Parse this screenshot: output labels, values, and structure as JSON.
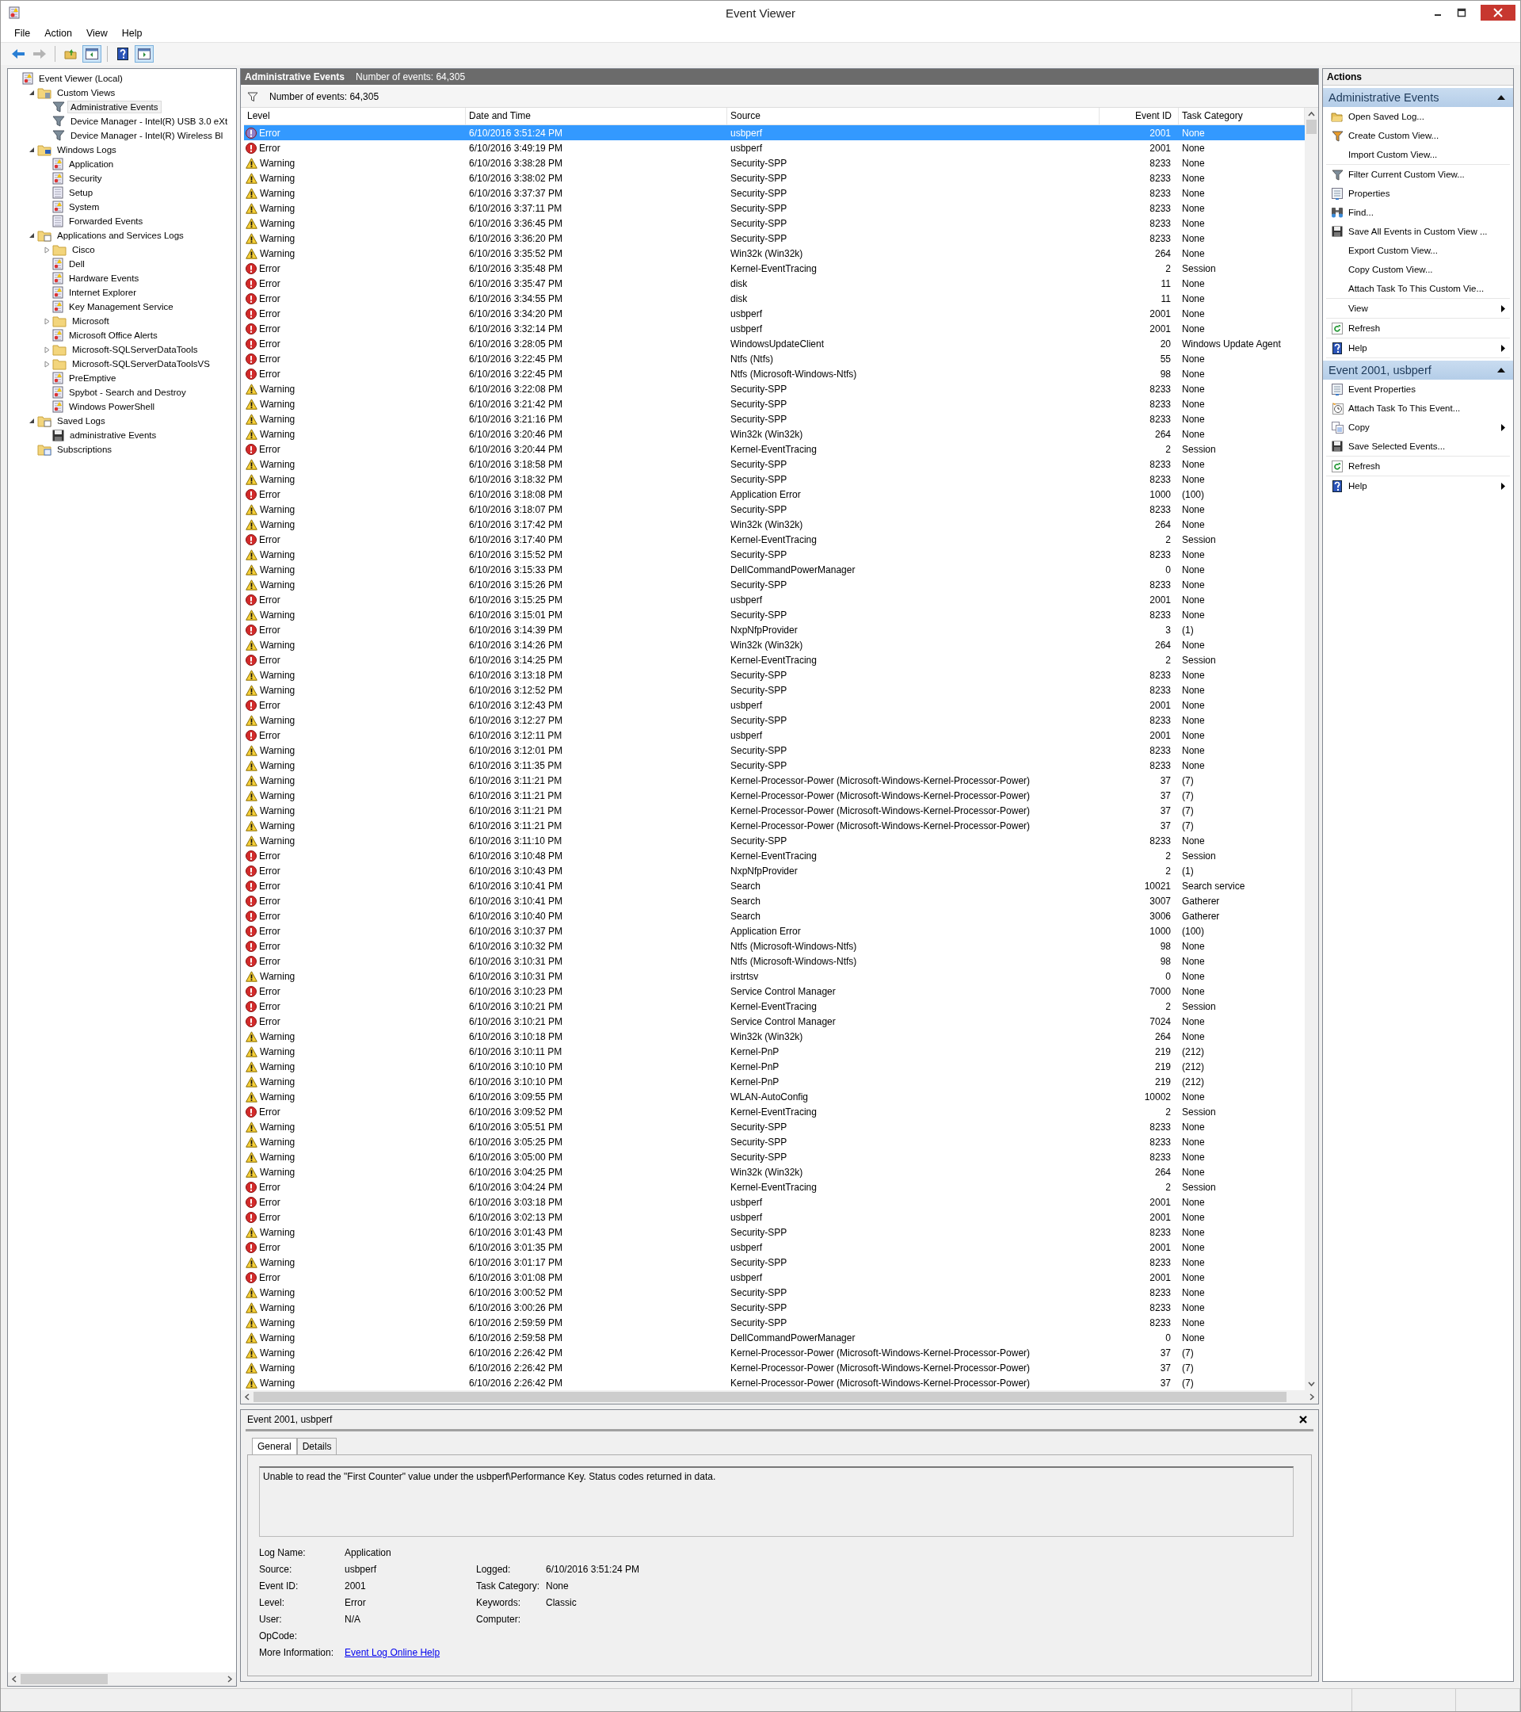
{
  "window": {
    "title": "Event Viewer"
  },
  "menu": [
    "File",
    "Action",
    "View",
    "Help"
  ],
  "toolbar": {
    "groups": [
      [
        {
          "kind": "back",
          "pressed": false,
          "disabled": false
        },
        {
          "kind": "forward",
          "pressed": false,
          "disabled": true
        }
      ],
      [
        {
          "kind": "up-folder",
          "pressed": false,
          "disabled": false
        },
        {
          "kind": "console-tree",
          "pressed": true,
          "disabled": false
        }
      ],
      [
        {
          "kind": "help",
          "pressed": false,
          "disabled": false
        },
        {
          "kind": "action-pane",
          "pressed": true,
          "disabled": false
        }
      ]
    ]
  },
  "tree": [
    {
      "label": "Event Viewer (Local)",
      "kind": "root",
      "selected": false,
      "children": [
        {
          "label": "Custom Views",
          "kind": "folder-filter",
          "expanded": true,
          "selected": false,
          "children": [
            {
              "label": "Administrative Events",
              "kind": "filter",
              "selected": true
            },
            {
              "label": "Device Manager - Intel(R) USB 3.0 eXt",
              "kind": "filter",
              "selected": false
            },
            {
              "label": "Device Manager - Intel(R) Wireless Bl",
              "kind": "filter",
              "selected": false
            }
          ]
        },
        {
          "label": "Windows Logs",
          "kind": "folder-computer",
          "expanded": true,
          "selected": false,
          "children": [
            {
              "label": "Application",
              "kind": "log",
              "selected": false
            },
            {
              "label": "Security",
              "kind": "log",
              "selected": false
            },
            {
              "label": "Setup",
              "kind": "plain-log",
              "selected": false
            },
            {
              "label": "System",
              "kind": "log",
              "selected": false
            },
            {
              "label": "Forwarded Events",
              "kind": "plain-log",
              "selected": false
            }
          ]
        },
        {
          "label": "Applications and Services Logs",
          "kind": "folder-window",
          "expanded": true,
          "selected": false,
          "children": [
            {
              "label": "Cisco",
              "kind": "folder",
              "expanded": false,
              "selected": false
            },
            {
              "label": "Dell",
              "kind": "log",
              "selected": false
            },
            {
              "label": "Hardware Events",
              "kind": "log",
              "selected": false
            },
            {
              "label": "Internet Explorer",
              "kind": "log",
              "selected": false
            },
            {
              "label": "Key Management Service",
              "kind": "log",
              "selected": false
            },
            {
              "label": "Microsoft",
              "kind": "folder",
              "expanded": false,
              "selected": false
            },
            {
              "label": "Microsoft Office Alerts",
              "kind": "log",
              "selected": false
            },
            {
              "label": "Microsoft-SQLServerDataTools",
              "kind": "folder",
              "expanded": false,
              "selected": false
            },
            {
              "label": "Microsoft-SQLServerDataToolsVS",
              "kind": "folder",
              "expanded": false,
              "selected": false
            },
            {
              "label": "PreEmptive",
              "kind": "log",
              "selected": false
            },
            {
              "label": "Spybot - Search and Destroy",
              "kind": "log",
              "selected": false
            },
            {
              "label": "Windows PowerShell",
              "kind": "log",
              "selected": false
            }
          ]
        },
        {
          "label": "Saved Logs",
          "kind": "folder-log",
          "expanded": true,
          "selected": false,
          "children": [
            {
              "label": "administrative Events",
              "kind": "saved",
              "selected": false
            }
          ]
        },
        {
          "label": "Subscriptions",
          "kind": "subscriptions",
          "selected": false
        }
      ]
    }
  ],
  "events": {
    "title": "Administrative Events",
    "count": "Number of events: 64,305",
    "filter_count": "Number of events: 64,305",
    "columns": [
      "Level",
      "Date and Time",
      "Source",
      "Event ID",
      "Task Category"
    ],
    "rows": [
      {
        "kind": "error",
        "severity": "Error",
        "date_time": "6/10/2016 3:51:24 PM",
        "source": "usbperf",
        "event_id": "2001",
        "task_category": "None",
        "selected": true
      },
      {
        "kind": "error",
        "severity": "Error",
        "date_time": "6/10/2016 3:49:19 PM",
        "source": "usbperf",
        "event_id": "2001",
        "task_category": "None",
        "selected": false
      },
      {
        "kind": "warning",
        "severity": "Warning",
        "date_time": "6/10/2016 3:38:28 PM",
        "source": "Security-SPP",
        "event_id": "8233",
        "task_category": "None",
        "selected": false
      },
      {
        "kind": "warning",
        "severity": "Warning",
        "date_time": "6/10/2016 3:38:02 PM",
        "source": "Security-SPP",
        "event_id": "8233",
        "task_category": "None",
        "selected": false
      },
      {
        "kind": "warning",
        "severity": "Warning",
        "date_time": "6/10/2016 3:37:37 PM",
        "source": "Security-SPP",
        "event_id": "8233",
        "task_category": "None",
        "selected": false
      },
      {
        "kind": "warning",
        "severity": "Warning",
        "date_time": "6/10/2016 3:37:11 PM",
        "source": "Security-SPP",
        "event_id": "8233",
        "task_category": "None",
        "selected": false
      },
      {
        "kind": "warning",
        "severity": "Warning",
        "date_time": "6/10/2016 3:36:45 PM",
        "source": "Security-SPP",
        "event_id": "8233",
        "task_category": "None",
        "selected": false
      },
      {
        "kind": "warning",
        "severity": "Warning",
        "date_time": "6/10/2016 3:36:20 PM",
        "source": "Security-SPP",
        "event_id": "8233",
        "task_category": "None",
        "selected": false
      },
      {
        "kind": "warning",
        "severity": "Warning",
        "date_time": "6/10/2016 3:35:52 PM",
        "source": "Win32k (Win32k)",
        "event_id": "264",
        "task_category": "None",
        "selected": false
      },
      {
        "kind": "error",
        "severity": "Error",
        "date_time": "6/10/2016 3:35:48 PM",
        "source": "Kernel-EventTracing",
        "event_id": "2",
        "task_category": "Session",
        "selected": false
      },
      {
        "kind": "error",
        "severity": "Error",
        "date_time": "6/10/2016 3:35:47 PM",
        "source": "disk",
        "event_id": "11",
        "task_category": "None",
        "selected": false
      },
      {
        "kind": "error",
        "severity": "Error",
        "date_time": "6/10/2016 3:34:55 PM",
        "source": "disk",
        "event_id": "11",
        "task_category": "None",
        "selected": false
      },
      {
        "kind": "error",
        "severity": "Error",
        "date_time": "6/10/2016 3:34:20 PM",
        "source": "usbperf",
        "event_id": "2001",
        "task_category": "None",
        "selected": false
      },
      {
        "kind": "error",
        "severity": "Error",
        "date_time": "6/10/2016 3:32:14 PM",
        "source": "usbperf",
        "event_id": "2001",
        "task_category": "None",
        "selected": false
      },
      {
        "kind": "error",
        "severity": "Error",
        "date_time": "6/10/2016 3:28:05 PM",
        "source": "WindowsUpdateClient",
        "event_id": "20",
        "task_category": "Windows Update Agent",
        "selected": false
      },
      {
        "kind": "error",
        "severity": "Error",
        "date_time": "6/10/2016 3:22:45 PM",
        "source": "Ntfs (Ntfs)",
        "event_id": "55",
        "task_category": "None",
        "selected": false
      },
      {
        "kind": "error",
        "severity": "Error",
        "date_time": "6/10/2016 3:22:45 PM",
        "source": "Ntfs (Microsoft-Windows-Ntfs)",
        "event_id": "98",
        "task_category": "None",
        "selected": false
      },
      {
        "kind": "warning",
        "severity": "Warning",
        "date_time": "6/10/2016 3:22:08 PM",
        "source": "Security-SPP",
        "event_id": "8233",
        "task_category": "None",
        "selected": false
      },
      {
        "kind": "warning",
        "severity": "Warning",
        "date_time": "6/10/2016 3:21:42 PM",
        "source": "Security-SPP",
        "event_id": "8233",
        "task_category": "None",
        "selected": false
      },
      {
        "kind": "warning",
        "severity": "Warning",
        "date_time": "6/10/2016 3:21:16 PM",
        "source": "Security-SPP",
        "event_id": "8233",
        "task_category": "None",
        "selected": false
      },
      {
        "kind": "warning",
        "severity": "Warning",
        "date_time": "6/10/2016 3:20:46 PM",
        "source": "Win32k (Win32k)",
        "event_id": "264",
        "task_category": "None",
        "selected": false
      },
      {
        "kind": "error",
        "severity": "Error",
        "date_time": "6/10/2016 3:20:44 PM",
        "source": "Kernel-EventTracing",
        "event_id": "2",
        "task_category": "Session",
        "selected": false
      },
      {
        "kind": "warning",
        "severity": "Warning",
        "date_time": "6/10/2016 3:18:58 PM",
        "source": "Security-SPP",
        "event_id": "8233",
        "task_category": "None",
        "selected": false
      },
      {
        "kind": "warning",
        "severity": "Warning",
        "date_time": "6/10/2016 3:18:32 PM",
        "source": "Security-SPP",
        "event_id": "8233",
        "task_category": "None",
        "selected": false
      },
      {
        "kind": "error",
        "severity": "Error",
        "date_time": "6/10/2016 3:18:08 PM",
        "source": "Application Error",
        "event_id": "1000",
        "task_category": "(100)",
        "selected": false
      },
      {
        "kind": "warning",
        "severity": "Warning",
        "date_time": "6/10/2016 3:18:07 PM",
        "source": "Security-SPP",
        "event_id": "8233",
        "task_category": "None",
        "selected": false
      },
      {
        "kind": "warning",
        "severity": "Warning",
        "date_time": "6/10/2016 3:17:42 PM",
        "source": "Win32k (Win32k)",
        "event_id": "264",
        "task_category": "None",
        "selected": false
      },
      {
        "kind": "error",
        "severity": "Error",
        "date_time": "6/10/2016 3:17:40 PM",
        "source": "Kernel-EventTracing",
        "event_id": "2",
        "task_category": "Session",
        "selected": false
      },
      {
        "kind": "warning",
        "severity": "Warning",
        "date_time": "6/10/2016 3:15:52 PM",
        "source": "Security-SPP",
        "event_id": "8233",
        "task_category": "None",
        "selected": false
      },
      {
        "kind": "warning",
        "severity": "Warning",
        "date_time": "6/10/2016 3:15:33 PM",
        "source": "DellCommandPowerManager",
        "event_id": "0",
        "task_category": "None",
        "selected": false
      },
      {
        "kind": "warning",
        "severity": "Warning",
        "date_time": "6/10/2016 3:15:26 PM",
        "source": "Security-SPP",
        "event_id": "8233",
        "task_category": "None",
        "selected": false
      },
      {
        "kind": "error",
        "severity": "Error",
        "date_time": "6/10/2016 3:15:25 PM",
        "source": "usbperf",
        "event_id": "2001",
        "task_category": "None",
        "selected": false
      },
      {
        "kind": "warning",
        "severity": "Warning",
        "date_time": "6/10/2016 3:15:01 PM",
        "source": "Security-SPP",
        "event_id": "8233",
        "task_category": "None",
        "selected": false
      },
      {
        "kind": "error",
        "severity": "Error",
        "date_time": "6/10/2016 3:14:39 PM",
        "source": "NxpNfpProvider",
        "event_id": "3",
        "task_category": "(1)",
        "selected": false
      },
      {
        "kind": "warning",
        "severity": "Warning",
        "date_time": "6/10/2016 3:14:26 PM",
        "source": "Win32k (Win32k)",
        "event_id": "264",
        "task_category": "None",
        "selected": false
      },
      {
        "kind": "error",
        "severity": "Error",
        "date_time": "6/10/2016 3:14:25 PM",
        "source": "Kernel-EventTracing",
        "event_id": "2",
        "task_category": "Session",
        "selected": false
      },
      {
        "kind": "warning",
        "severity": "Warning",
        "date_time": "6/10/2016 3:13:18 PM",
        "source": "Security-SPP",
        "event_id": "8233",
        "task_category": "None",
        "selected": false
      },
      {
        "kind": "warning",
        "severity": "Warning",
        "date_time": "6/10/2016 3:12:52 PM",
        "source": "Security-SPP",
        "event_id": "8233",
        "task_category": "None",
        "selected": false
      },
      {
        "kind": "error",
        "severity": "Error",
        "date_time": "6/10/2016 3:12:43 PM",
        "source": "usbperf",
        "event_id": "2001",
        "task_category": "None",
        "selected": false
      },
      {
        "kind": "warning",
        "severity": "Warning",
        "date_time": "6/10/2016 3:12:27 PM",
        "source": "Security-SPP",
        "event_id": "8233",
        "task_category": "None",
        "selected": false
      },
      {
        "kind": "error",
        "severity": "Error",
        "date_time": "6/10/2016 3:12:11 PM",
        "source": "usbperf",
        "event_id": "2001",
        "task_category": "None",
        "selected": false
      },
      {
        "kind": "warning",
        "severity": "Warning",
        "date_time": "6/10/2016 3:12:01 PM",
        "source": "Security-SPP",
        "event_id": "8233",
        "task_category": "None",
        "selected": false
      },
      {
        "kind": "warning",
        "severity": "Warning",
        "date_time": "6/10/2016 3:11:35 PM",
        "source": "Security-SPP",
        "event_id": "8233",
        "task_category": "None",
        "selected": false
      },
      {
        "kind": "warning",
        "severity": "Warning",
        "date_time": "6/10/2016 3:11:21 PM",
        "source": "Kernel-Processor-Power (Microsoft-Windows-Kernel-Processor-Power)",
        "event_id": "37",
        "task_category": "(7)",
        "selected": false
      },
      {
        "kind": "warning",
        "severity": "Warning",
        "date_time": "6/10/2016 3:11:21 PM",
        "source": "Kernel-Processor-Power (Microsoft-Windows-Kernel-Processor-Power)",
        "event_id": "37",
        "task_category": "(7)",
        "selected": false
      },
      {
        "kind": "warning",
        "severity": "Warning",
        "date_time": "6/10/2016 3:11:21 PM",
        "source": "Kernel-Processor-Power (Microsoft-Windows-Kernel-Processor-Power)",
        "event_id": "37",
        "task_category": "(7)",
        "selected": false
      },
      {
        "kind": "warning",
        "severity": "Warning",
        "date_time": "6/10/2016 3:11:21 PM",
        "source": "Kernel-Processor-Power (Microsoft-Windows-Kernel-Processor-Power)",
        "event_id": "37",
        "task_category": "(7)",
        "selected": false
      },
      {
        "kind": "warning",
        "severity": "Warning",
        "date_time": "6/10/2016 3:11:10 PM",
        "source": "Security-SPP",
        "event_id": "8233",
        "task_category": "None",
        "selected": false
      },
      {
        "kind": "error",
        "severity": "Error",
        "date_time": "6/10/2016 3:10:48 PM",
        "source": "Kernel-EventTracing",
        "event_id": "2",
        "task_category": "Session",
        "selected": false
      },
      {
        "kind": "error",
        "severity": "Error",
        "date_time": "6/10/2016 3:10:43 PM",
        "source": "NxpNfpProvider",
        "event_id": "2",
        "task_category": "(1)",
        "selected": false
      },
      {
        "kind": "error",
        "severity": "Error",
        "date_time": "6/10/2016 3:10:41 PM",
        "source": "Search",
        "event_id": "10021",
        "task_category": "Search service",
        "selected": false
      },
      {
        "kind": "error",
        "severity": "Error",
        "date_time": "6/10/2016 3:10:41 PM",
        "source": "Search",
        "event_id": "3007",
        "task_category": "Gatherer",
        "selected": false
      },
      {
        "kind": "error",
        "severity": "Error",
        "date_time": "6/10/2016 3:10:40 PM",
        "source": "Search",
        "event_id": "3006",
        "task_category": "Gatherer",
        "selected": false
      },
      {
        "kind": "error",
        "severity": "Error",
        "date_time": "6/10/2016 3:10:37 PM",
        "source": "Application Error",
        "event_id": "1000",
        "task_category": "(100)",
        "selected": false
      },
      {
        "kind": "error",
        "severity": "Error",
        "date_time": "6/10/2016 3:10:32 PM",
        "source": "Ntfs (Microsoft-Windows-Ntfs)",
        "event_id": "98",
        "task_category": "None",
        "selected": false
      },
      {
        "kind": "error",
        "severity": "Error",
        "date_time": "6/10/2016 3:10:31 PM",
        "source": "Ntfs (Microsoft-Windows-Ntfs)",
        "event_id": "98",
        "task_category": "None",
        "selected": false
      },
      {
        "kind": "warning",
        "severity": "Warning",
        "date_time": "6/10/2016 3:10:31 PM",
        "source": "irstrtsv",
        "event_id": "0",
        "task_category": "None",
        "selected": false
      },
      {
        "kind": "error",
        "severity": "Error",
        "date_time": "6/10/2016 3:10:23 PM",
        "source": "Service Control Manager",
        "event_id": "7000",
        "task_category": "None",
        "selected": false
      },
      {
        "kind": "error",
        "severity": "Error",
        "date_time": "6/10/2016 3:10:21 PM",
        "source": "Kernel-EventTracing",
        "event_id": "2",
        "task_category": "Session",
        "selected": false
      },
      {
        "kind": "error",
        "severity": "Error",
        "date_time": "6/10/2016 3:10:21 PM",
        "source": "Service Control Manager",
        "event_id": "7024",
        "task_category": "None",
        "selected": false
      },
      {
        "kind": "warning",
        "severity": "Warning",
        "date_time": "6/10/2016 3:10:18 PM",
        "source": "Win32k (Win32k)",
        "event_id": "264",
        "task_category": "None",
        "selected": false
      },
      {
        "kind": "warning",
        "severity": "Warning",
        "date_time": "6/10/2016 3:10:11 PM",
        "source": "Kernel-PnP",
        "event_id": "219",
        "task_category": "(212)",
        "selected": false
      },
      {
        "kind": "warning",
        "severity": "Warning",
        "date_time": "6/10/2016 3:10:10 PM",
        "source": "Kernel-PnP",
        "event_id": "219",
        "task_category": "(212)",
        "selected": false
      },
      {
        "kind": "warning",
        "severity": "Warning",
        "date_time": "6/10/2016 3:10:10 PM",
        "source": "Kernel-PnP",
        "event_id": "219",
        "task_category": "(212)",
        "selected": false
      },
      {
        "kind": "warning",
        "severity": "Warning",
        "date_time": "6/10/2016 3:09:55 PM",
        "source": "WLAN-AutoConfig",
        "event_id": "10002",
        "task_category": "None",
        "selected": false
      },
      {
        "kind": "error",
        "severity": "Error",
        "date_time": "6/10/2016 3:09:52 PM",
        "source": "Kernel-EventTracing",
        "event_id": "2",
        "task_category": "Session",
        "selected": false
      },
      {
        "kind": "warning",
        "severity": "Warning",
        "date_time": "6/10/2016 3:05:51 PM",
        "source": "Security-SPP",
        "event_id": "8233",
        "task_category": "None",
        "selected": false
      },
      {
        "kind": "warning",
        "severity": "Warning",
        "date_time": "6/10/2016 3:05:25 PM",
        "source": "Security-SPP",
        "event_id": "8233",
        "task_category": "None",
        "selected": false
      },
      {
        "kind": "warning",
        "severity": "Warning",
        "date_time": "6/10/2016 3:05:00 PM",
        "source": "Security-SPP",
        "event_id": "8233",
        "task_category": "None",
        "selected": false
      },
      {
        "kind": "warning",
        "severity": "Warning",
        "date_time": "6/10/2016 3:04:25 PM",
        "source": "Win32k (Win32k)",
        "event_id": "264",
        "task_category": "None",
        "selected": false
      },
      {
        "kind": "error",
        "severity": "Error",
        "date_time": "6/10/2016 3:04:24 PM",
        "source": "Kernel-EventTracing",
        "event_id": "2",
        "task_category": "Session",
        "selected": false
      },
      {
        "kind": "error",
        "severity": "Error",
        "date_time": "6/10/2016 3:03:18 PM",
        "source": "usbperf",
        "event_id": "2001",
        "task_category": "None",
        "selected": false
      },
      {
        "kind": "error",
        "severity": "Error",
        "date_time": "6/10/2016 3:02:13 PM",
        "source": "usbperf",
        "event_id": "2001",
        "task_category": "None",
        "selected": false
      },
      {
        "kind": "warning",
        "severity": "Warning",
        "date_time": "6/10/2016 3:01:43 PM",
        "source": "Security-SPP",
        "event_id": "8233",
        "task_category": "None",
        "selected": false
      },
      {
        "kind": "error",
        "severity": "Error",
        "date_time": "6/10/2016 3:01:35 PM",
        "source": "usbperf",
        "event_id": "2001",
        "task_category": "None",
        "selected": false
      },
      {
        "kind": "warning",
        "severity": "Warning",
        "date_time": "6/10/2016 3:01:17 PM",
        "source": "Security-SPP",
        "event_id": "8233",
        "task_category": "None",
        "selected": false
      },
      {
        "kind": "error",
        "severity": "Error",
        "date_time": "6/10/2016 3:01:08 PM",
        "source": "usbperf",
        "event_id": "2001",
        "task_category": "None",
        "selected": false
      },
      {
        "kind": "warning",
        "severity": "Warning",
        "date_time": "6/10/2016 3:00:52 PM",
        "source": "Security-SPP",
        "event_id": "8233",
        "task_category": "None",
        "selected": false
      },
      {
        "kind": "warning",
        "severity": "Warning",
        "date_time": "6/10/2016 3:00:26 PM",
        "source": "Security-SPP",
        "event_id": "8233",
        "task_category": "None",
        "selected": false
      },
      {
        "kind": "warning",
        "severity": "Warning",
        "date_time": "6/10/2016 2:59:59 PM",
        "source": "Security-SPP",
        "event_id": "8233",
        "task_category": "None",
        "selected": false
      },
      {
        "kind": "warning",
        "severity": "Warning",
        "date_time": "6/10/2016 2:59:58 PM",
        "source": "DellCommandPowerManager",
        "event_id": "0",
        "task_category": "None",
        "selected": false
      },
      {
        "kind": "warning",
        "severity": "Warning",
        "date_time": "6/10/2016 2:26:42 PM",
        "source": "Kernel-Processor-Power (Microsoft-Windows-Kernel-Processor-Power)",
        "event_id": "37",
        "task_category": "(7)",
        "selected": false
      },
      {
        "kind": "warning",
        "severity": "Warning",
        "date_time": "6/10/2016 2:26:42 PM",
        "source": "Kernel-Processor-Power (Microsoft-Windows-Kernel-Processor-Power)",
        "event_id": "37",
        "task_category": "(7)",
        "selected": false
      },
      {
        "kind": "warning",
        "severity": "Warning",
        "date_time": "6/10/2016 2:26:42 PM",
        "source": "Kernel-Processor-Power (Microsoft-Windows-Kernel-Processor-Power)",
        "event_id": "37",
        "task_category": "(7)",
        "selected": false
      }
    ]
  },
  "details": {
    "title": "Event 2001, usbperf",
    "tabs": [
      {
        "label": "General",
        "selected": true
      },
      {
        "label": "Details",
        "selected": false
      }
    ],
    "message": "Unable to read the \"First Counter\" value under the usbperf\\Performance Key. Status codes returned in data.",
    "rows": [
      {
        "left": {
          "label": "Log Name:",
          "value": "Application"
        }
      },
      {
        "left": {
          "label": "Source:",
          "value": "usbperf"
        },
        "right": {
          "label": "Logged:",
          "value": "6/10/2016 3:51:24 PM"
        }
      },
      {
        "left": {
          "label": "Event ID:",
          "value": "2001"
        },
        "right": {
          "label": "Task Category:",
          "value": "None"
        }
      },
      {
        "left": {
          "label": "Level:",
          "value": "Error"
        },
        "right": {
          "label": "Keywords:",
          "value": "Classic"
        }
      },
      {
        "left": {
          "label": "User:",
          "value": "N/A"
        },
        "right": {
          "label": "Computer:"
        }
      },
      {
        "left": {
          "label": "OpCode:"
        }
      },
      {
        "left": {
          "label": "More Information:",
          "link": "Event Log Online Help"
        }
      }
    ]
  },
  "actions": {
    "title": "Actions",
    "sections": [
      {
        "title": "Administrative Events",
        "expanded": true,
        "groups": [
          [
            {
              "label": "Open Saved Log...",
              "kind": "open-folder",
              "submenu": false
            },
            {
              "label": "Create Custom View...",
              "kind": "funnel-star",
              "submenu": false
            },
            {
              "label": "Import Custom View...",
              "kind": "none",
              "submenu": false
            }
          ],
          [
            {
              "label": "Filter Current Custom View...",
              "kind": "funnel",
              "submenu": false
            },
            {
              "label": "Properties",
              "kind": "properties",
              "submenu": false
            },
            {
              "label": "Find...",
              "kind": "binoculars",
              "submenu": false
            },
            {
              "label": "Save All Events in Custom View ...",
              "kind": "floppy",
              "submenu": false
            },
            {
              "label": "Export Custom View...",
              "kind": "none",
              "submenu": false
            },
            {
              "label": "Copy Custom View...",
              "kind": "none",
              "submenu": false
            },
            {
              "label": "Attach Task To This Custom Vie...",
              "kind": "none",
              "submenu": false
            }
          ],
          [
            {
              "label": "View",
              "kind": "none",
              "submenu": true
            }
          ],
          [
            {
              "label": "Refresh",
              "kind": "refresh",
              "submenu": false
            }
          ],
          [
            {
              "label": "Help",
              "kind": "help",
              "submenu": true
            }
          ]
        ]
      },
      {
        "title": "Event 2001, usbperf",
        "expanded": true,
        "groups": [
          [
            {
              "label": "Event Properties",
              "kind": "properties",
              "submenu": false
            },
            {
              "label": "Attach Task To This Event...",
              "kind": "clock",
              "submenu": false
            },
            {
              "label": "Copy",
              "kind": "copy",
              "submenu": true
            },
            {
              "label": "Save Selected Events...",
              "kind": "floppy",
              "submenu": false
            }
          ],
          [
            {
              "label": "Refresh",
              "kind": "refresh",
              "submenu": false
            }
          ],
          [
            {
              "label": "Help",
              "kind": "help",
              "submenu": true
            }
          ]
        ]
      }
    ]
  }
}
